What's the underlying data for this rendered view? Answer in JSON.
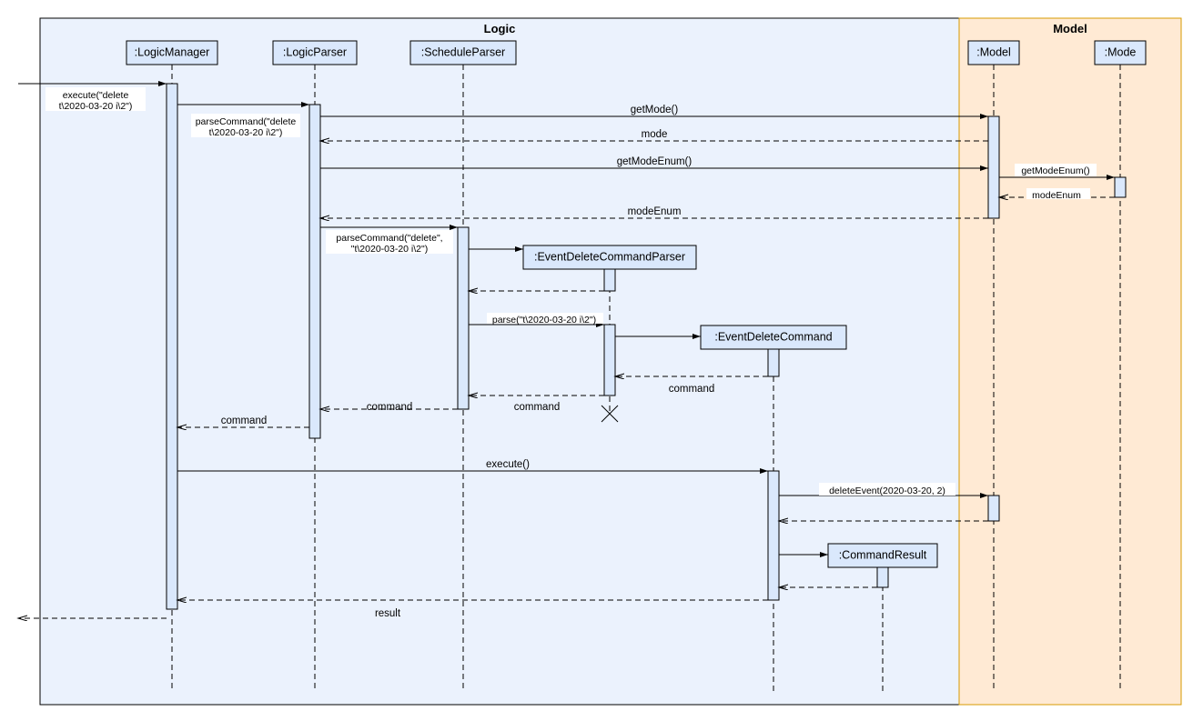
{
  "regions": {
    "logic_title": "Logic",
    "model_title": "Model"
  },
  "participants": {
    "logicManager": ":LogicManager",
    "logicParser": ":LogicParser",
    "scheduleParser": ":ScheduleParser",
    "eventDeleteCommandParser": ":EventDeleteCommandParser",
    "eventDeleteCommand": ":EventDeleteCommand",
    "commandResult": ":CommandResult",
    "model": ":Model",
    "mode": ":Mode"
  },
  "messages": {
    "execute1a": "execute(\"delete",
    "execute1b": "t\\2020-03-20 i\\2\")",
    "parseCommand1a": "parseCommand(\"delete",
    "parseCommand1b": "t\\2020-03-20 i\\2\")",
    "getMode": "getMode()",
    "modeReturn": "mode",
    "getModeEnum": "getModeEnum()",
    "getModeEnum2": "getModeEnum()",
    "modeEnum": "modeEnum",
    "modeEnumReturn": "modeEnum",
    "parseCommand2a": "parseCommand(\"delete\",",
    "parseCommand2b": "\"t\\2020-03-20 i\\2\")",
    "parse": "parse(\"t\\2020-03-20 i\\2\")",
    "commandReturn": "command",
    "execute2": "execute()",
    "deleteEvent": "deleteEvent(2020-03-20, 2)",
    "resultReturn": "result"
  }
}
